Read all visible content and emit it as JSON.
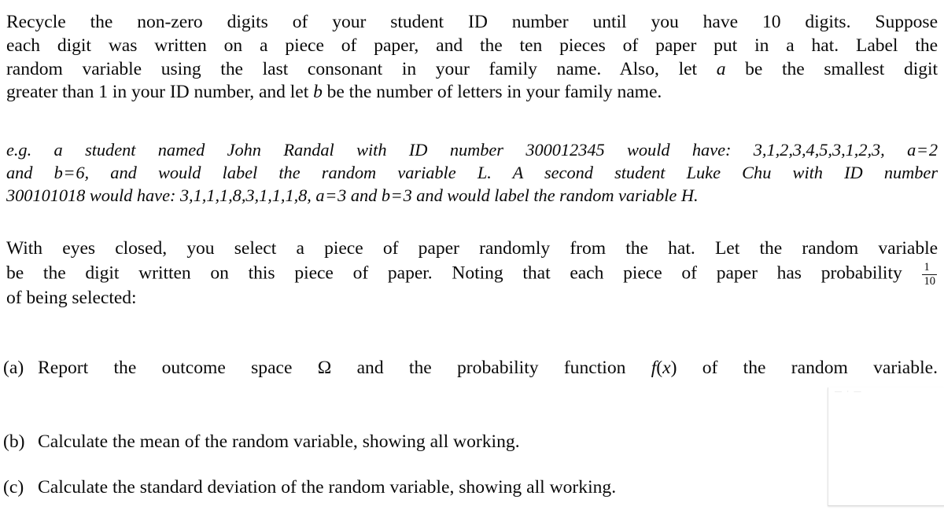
{
  "document": {
    "paragraph1": {
      "line1": "Recycle the non-zero digits of your student ID number until you have 10 digits.  Suppose",
      "line2": "each digit was written on a piece of paper, and the ten pieces of paper put in a hat. Label the",
      "line3_a": "random variable using the last consonant in your family name. Also, let ",
      "line3_var": "a",
      "line3_b": " be the smallest digit",
      "line4_a": "greater than 1 in your ID number, and let ",
      "line4_var": "b",
      "line4_b": " be the number of letters in your family name."
    },
    "paragraph2_example": {
      "line1_a": "e.g. a student named John Randal with ID number 300012345 would have: 3,1,2,3,4,5,3,1,2,3, ",
      "line1_var": "a",
      "line1_eq": "=",
      "line1_val": "2",
      "line2_a": "and ",
      "line2_var": "b",
      "line2_eq": "=",
      "line2_val": "6",
      "line2_b": ", and would label the random variable ",
      "line2_rv": "L",
      "line2_c": ".  A second student Luke Chu with ID number",
      "line3_a": "300101018 would have: 3,1,1,1,8,3,1,1,1,8, ",
      "line3_var": "a",
      "line3_eq": "=",
      "line3_val": "3",
      "line3_b": " and ",
      "line3_var2": "b",
      "line3_eq2": "=",
      "line3_val2": "3",
      "line3_c": " and would label the random variable ",
      "line3_rv": "H",
      "line3_d": "."
    },
    "paragraph3": {
      "line1": "With eyes closed, you select a piece of paper randomly from the hat. Let the random variable",
      "line2_a": "be the digit written on this piece of paper. Noting that each piece of paper has probability ",
      "line2_frac_num": "1",
      "line2_frac_den": "10",
      "line3": "of being selected:"
    },
    "items": [
      {
        "marker": "(a)",
        "text_a": "Report the outcome space ",
        "symbol_omega": "Ω",
        "text_b": " and the probability function ",
        "math_f": "f",
        "math_paren_open": "(",
        "math_x": "x",
        "math_paren_close": ")",
        "text_c": " of the random variable."
      },
      {
        "marker": "(b)",
        "text": "Calculate the mean of the random variable, showing all working."
      },
      {
        "marker": "(c)",
        "text": "Calculate the standard deviation of the random variable, showing all working."
      }
    ],
    "overlay_card": {
      "ghost_text": "—    ·     —"
    }
  }
}
